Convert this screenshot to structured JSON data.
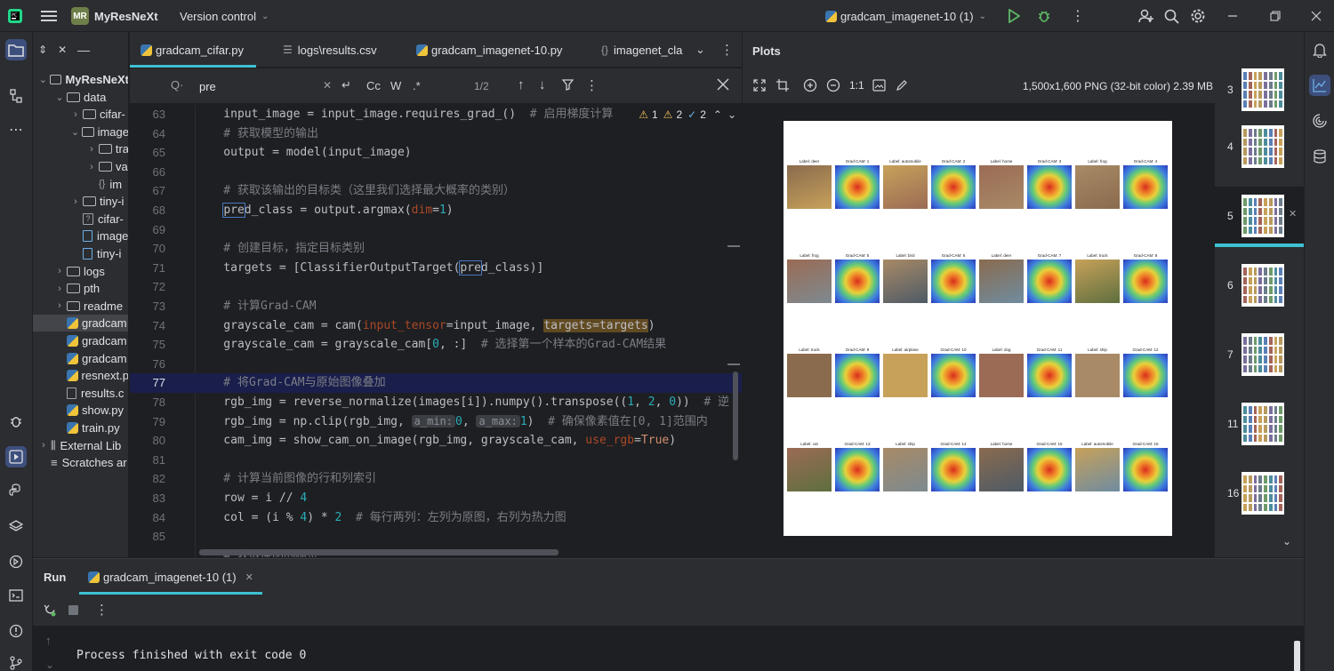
{
  "titlebar": {
    "project_badge": "MR",
    "project_name": "MyResNeXt",
    "vcs": "Version control",
    "run_config": "gradcam_imagenet-10 (1)"
  },
  "project_tree": [
    {
      "label": "MyResNeXt",
      "indent": 0,
      "type": "folder",
      "expanded": true,
      "bold": true
    },
    {
      "label": "data",
      "indent": 1,
      "type": "folder",
      "expanded": true
    },
    {
      "label": "cifar-",
      "indent": 2,
      "type": "folder",
      "expanded": false
    },
    {
      "label": "image",
      "indent": 2,
      "type": "folder",
      "expanded": true
    },
    {
      "label": "tra",
      "indent": 3,
      "type": "folder",
      "expanded": false
    },
    {
      "label": "va",
      "indent": 3,
      "type": "folder",
      "expanded": false
    },
    {
      "label": "im",
      "indent": 3,
      "type": "json"
    },
    {
      "label": "tiny-i",
      "indent": 2,
      "type": "folder",
      "expanded": false
    },
    {
      "label": "cifar-",
      "indent": 2,
      "type": "unknown"
    },
    {
      "label": "image",
      "indent": 2,
      "type": "zip"
    },
    {
      "label": "tiny-i",
      "indent": 2,
      "type": "zip"
    },
    {
      "label": "logs",
      "indent": 1,
      "type": "folder",
      "expanded": false
    },
    {
      "label": "pth",
      "indent": 1,
      "type": "folder",
      "expanded": false
    },
    {
      "label": "readme",
      "indent": 1,
      "type": "folder",
      "expanded": false
    },
    {
      "label": "gradcam",
      "indent": 1,
      "type": "py",
      "selected": true
    },
    {
      "label": "gradcam",
      "indent": 1,
      "type": "py"
    },
    {
      "label": "gradcam",
      "indent": 1,
      "type": "py"
    },
    {
      "label": "resnext.p",
      "indent": 1,
      "type": "py"
    },
    {
      "label": "results.c",
      "indent": 1,
      "type": "txt"
    },
    {
      "label": "show.py",
      "indent": 1,
      "type": "py"
    },
    {
      "label": "train.py",
      "indent": 1,
      "type": "py"
    },
    {
      "label": "External Lib",
      "indent": 0,
      "type": "lib",
      "expanded": false
    },
    {
      "label": "Scratches ar",
      "indent": 0,
      "type": "scratch"
    }
  ],
  "editor_tabs": [
    {
      "label": "gradcam_cifar.py",
      "icon": "python-icon",
      "active": true
    },
    {
      "label": "logs\\results.csv",
      "icon": "csv-icon",
      "active": false
    },
    {
      "label": "gradcam_imagenet-10.py",
      "icon": "python-icon",
      "active": false
    },
    {
      "label": "imagenet_cla",
      "icon": "json-icon",
      "active": false
    }
  ],
  "search": {
    "value": "pre",
    "placeholder": "",
    "match_count": "1/2",
    "option_case": "Cc",
    "option_word": "W",
    "option_regex": ".*"
  },
  "inspections": {
    "warnings": "1",
    "weak_warnings": "2",
    "typos": "2"
  },
  "code_lines": [
    {
      "n": "63",
      "cur": false
    },
    {
      "n": "64",
      "cur": false
    },
    {
      "n": "65",
      "cur": false
    },
    {
      "n": "66",
      "cur": false
    },
    {
      "n": "67",
      "cur": false
    },
    {
      "n": "68",
      "cur": false
    },
    {
      "n": "69",
      "cur": false
    },
    {
      "n": "70",
      "cur": false
    },
    {
      "n": "71",
      "cur": false
    },
    {
      "n": "72",
      "cur": false
    },
    {
      "n": "73",
      "cur": false
    },
    {
      "n": "74",
      "cur": false
    },
    {
      "n": "75",
      "cur": false
    },
    {
      "n": "76",
      "cur": false
    },
    {
      "n": "77",
      "cur": true
    },
    {
      "n": "78",
      "cur": false
    },
    {
      "n": "79",
      "cur": false
    },
    {
      "n": "80",
      "cur": false
    },
    {
      "n": "81",
      "cur": false
    },
    {
      "n": "82",
      "cur": false
    },
    {
      "n": "83",
      "cur": false
    },
    {
      "n": "84",
      "cur": false
    },
    {
      "n": "85",
      "cur": false
    }
  ],
  "code_text": {
    "l63a": "    input_image = input_image.requires_grad_()  ",
    "l63c": "# 启用梯度计算",
    "l64": "    # 获取模型的输出",
    "l65": "    output = model(input_image)",
    "l67": "    # 获取该输出的目标类（这里我们选择最大概率的类别）",
    "l68a": "    ",
    "l68b": "pre",
    "l68c": "d_class = output.argmax(",
    "l68d": "dim",
    "l68e": "=",
    "l68f": "1",
    "l68g": ")",
    "l70": "    # 创建目标，指定目标类别",
    "l71a": "    targets = [ClassifierOutputTarget(",
    "l71b": "pre",
    "l71c": "d_class)]",
    "l73": "    # 计算Grad-CAM",
    "l74a": "    grayscale_cam = cam(",
    "l74b": "input_tensor",
    "l74c": "=input_image, ",
    "l74d": "targets=targets",
    "l74e": ")",
    "l75a": "    grayscale_cam = grayscale_cam[",
    "l75b": "0",
    "l75c": ", :]  ",
    "l75d": "# 选择第一个样本的Grad-CAM结果",
    "l77": "    # 将Grad-CAM与原始图像叠加",
    "l78a": "    rgb_img = reverse_normalize(images[i]).numpy().transpose((",
    "l78b": "1",
    "l78c": ", ",
    "l78d": "2",
    "l78e": ", ",
    "l78f": "0",
    "l78g": "))  ",
    "l78h": "# 逆",
    "l79a": "    rgb_img = np.clip(rgb_img, ",
    "l79b": "a_min:",
    "l79c": "0",
    "l79d": ", ",
    "l79e": "a_max:",
    "l79f": "1",
    "l79g": ")  ",
    "l79h": "# 确保像素值在[0, 1]范围内",
    "l80a": "    cam_img = show_cam_on_image(rgb_img, grayscale_cam, ",
    "l80b": "use_rgb",
    "l80c": "=",
    "l80d": "True",
    "l80e": ")",
    "l82": "    # 计算当前图像的行和列索引",
    "l83a": "    row = i // ",
    "l83b": "4",
    "l84a": "    col = (i % ",
    "l84b": "4",
    "l84c": ") * ",
    "l84d": "2",
    "l84e": "  ",
    "l84f": "# 每行两列：左列为原图，右列为热力图",
    "l86": "    # 获取原图的标签"
  },
  "plots": {
    "title": "Plots",
    "zoom": "1:1",
    "info": "1,500x1,600 PNG (32-bit color) 2.39 MB",
    "image_grid": [
      [
        "Label: deer",
        "Grad-CAM: 1",
        "Label: automobile",
        "Grad-CAM: 2",
        "Label: horse",
        "Grad-CAM: 3",
        "Label: frog",
        "Grad-CAM: 4"
      ],
      [
        "Label: frog",
        "Grad-CAM: 5",
        "Label: bird",
        "Grad-CAM: 6",
        "Label: deer",
        "Grad-CAM: 7",
        "Label: truck",
        "Grad-CAM: 8"
      ],
      [
        "Label: truck",
        "Grad-CAM: 9",
        "Label: airplane",
        "Grad-CAM: 10",
        "Label: dog",
        "Grad-CAM: 11",
        "Label: ship",
        "Grad-CAM: 12"
      ],
      [
        "Label: cat",
        "Grad-CAM: 13",
        "Label: ship",
        "Grad-CAM: 14",
        "Label: horse",
        "Grad-CAM: 15",
        "Label: automobile",
        "Grad-CAM: 16"
      ]
    ],
    "thumbnails": [
      {
        "num": "3",
        "selected": false
      },
      {
        "num": "4",
        "selected": false
      },
      {
        "num": "5",
        "selected": true
      },
      {
        "num": "6",
        "selected": false
      },
      {
        "num": "7",
        "selected": false
      },
      {
        "num": "11",
        "selected": false
      },
      {
        "num": "16",
        "selected": false
      }
    ]
  },
  "run": {
    "title": "Run",
    "tab": "gradcam_imagenet-10 (1)",
    "output": "Process finished with exit code 0"
  },
  "colors": {
    "accent": "#3ec1d3",
    "run_green": "#5fb865",
    "selection_line": "#1a1e4b",
    "highlight": "#614a22"
  }
}
